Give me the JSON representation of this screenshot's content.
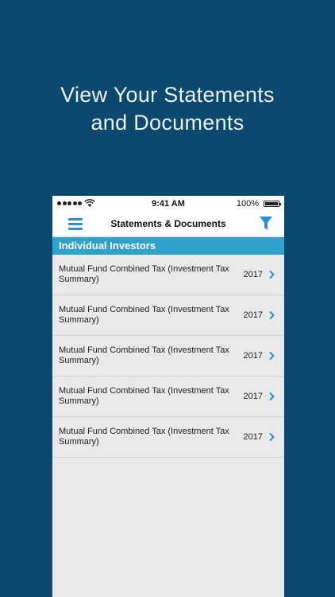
{
  "promo": {
    "headline_line1": "View Your Statements",
    "headline_line2": "and Documents"
  },
  "status_bar": {
    "time": "9:41 AM",
    "battery": "100%"
  },
  "nav_bar": {
    "title": "Statements & Documents",
    "menu_icon": "hamburger-menu-icon",
    "filter_icon": "filter-funnel-icon"
  },
  "section": {
    "title": "Individual Investors"
  },
  "documents": [
    {
      "label": "Mutual Fund Combined Tax (Investment Tax Summary)",
      "year": "2017"
    },
    {
      "label": "Mutual Fund Combined Tax (Investment Tax Summary)",
      "year": "2017"
    },
    {
      "label": "Mutual Fund Combined Tax (Investment Tax Summary)",
      "year": "2017"
    },
    {
      "label": "Mutual Fund Combined Tax (Investment Tax Summary)",
      "year": "2017"
    },
    {
      "label": "Mutual Fund Combined Tax (Investment Tax Summary)",
      "year": "2017"
    }
  ],
  "colors": {
    "background": "#0b4a6e",
    "accent": "#2e8fd1",
    "section_header": "#2fa1cb",
    "list_background": "#e9e9e9"
  }
}
